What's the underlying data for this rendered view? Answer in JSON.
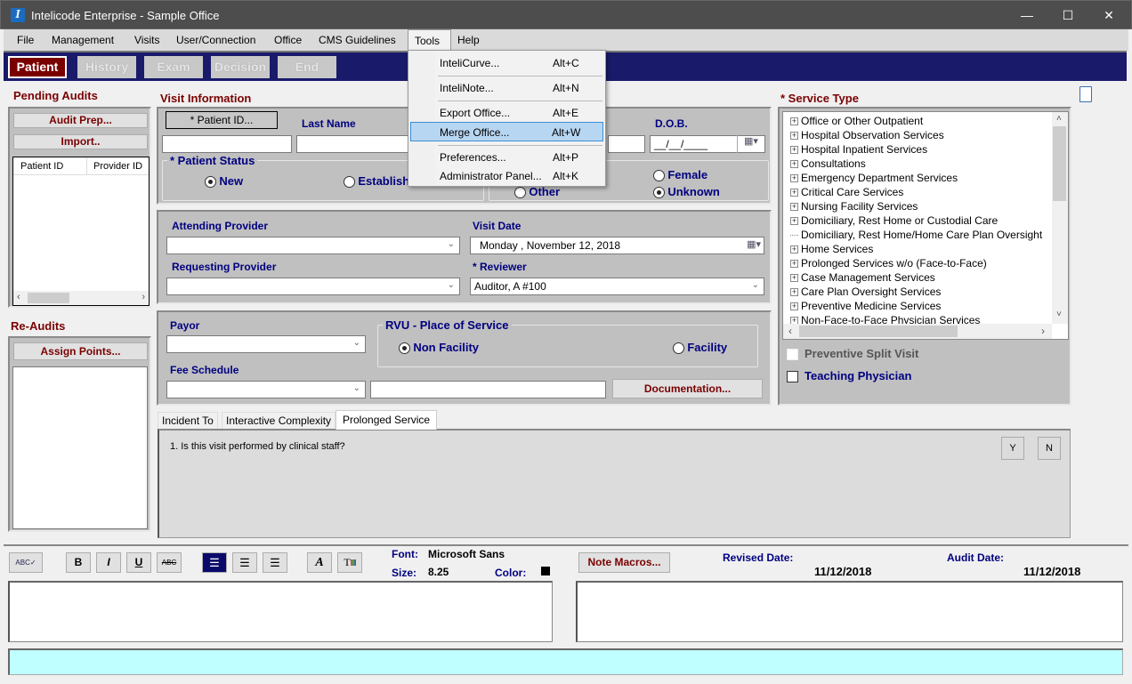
{
  "window": {
    "title": "Intelicode Enterprise  - Sample Office",
    "app_icon": "intelicode-logo-icon",
    "minimize": "—",
    "maximize": "☐",
    "close": "✕"
  },
  "menu": {
    "items": [
      "File",
      "Management",
      "Visits",
      "User/Connection",
      "Office",
      "CMS Guidelines",
      "Tools",
      "Help"
    ],
    "open": "Tools"
  },
  "tools_menu": {
    "items": [
      {
        "label": "InteliCurve...",
        "shortcut": "Alt+C"
      },
      {
        "label": "InteliNote...",
        "shortcut": "Alt+N"
      },
      {
        "label": "Export Office...",
        "shortcut": "Alt+E"
      },
      {
        "label": "Merge Office...",
        "shortcut": "Alt+W",
        "highlighted": true
      },
      {
        "label": "Preferences...",
        "shortcut": "Alt+P"
      },
      {
        "label": "Administrator Panel...",
        "shortcut": "Alt+K"
      }
    ]
  },
  "wizard_tabs": [
    {
      "label": "Patient",
      "active": true
    },
    {
      "label": "History",
      "active": false
    },
    {
      "label": "Exam",
      "active": false
    },
    {
      "label": "Decision",
      "active": false
    },
    {
      "label": "End",
      "active": false
    }
  ],
  "pending_audits": {
    "title": "Pending Audits",
    "audit_prep": "Audit Prep...",
    "import": "Import..",
    "columns": [
      "Patient ID",
      "Provider ID"
    ],
    "rows": []
  },
  "re_audits": {
    "title": "Re-Audits",
    "assign_points": "Assign Points..."
  },
  "visit_info": {
    "title": "Visit Information",
    "patient_id_button": "* Patient ID...",
    "last_name_label": "Last Name",
    "dob_label": "D.O.B.",
    "dob_value": "__/__/____",
    "patient_status_label": "* Patient Status",
    "status_options": [
      {
        "label": "New",
        "selected": true
      },
      {
        "label": "Established",
        "selected": false
      }
    ],
    "gender_options": [
      {
        "label": "Other",
        "selected": false
      },
      {
        "label": "Female",
        "selected": false
      },
      {
        "label": "Unknown",
        "selected": true
      }
    ],
    "attending_provider_label": "Attending Provider",
    "attending_provider_value": "",
    "visit_date_label": "Visit Date",
    "visit_date_value": "Monday   , November 12, 2018",
    "requesting_provider_label": "Requesting Provider",
    "requesting_provider_value": "",
    "reviewer_label": "* Reviewer",
    "reviewer_value": "Auditor, A #100",
    "payor_label": "Payor",
    "fee_schedule_label": "Fee Schedule",
    "rvu_label": "RVU - Place of Service",
    "rvu_options": [
      {
        "label": "Non Facility",
        "selected": true
      },
      {
        "label": "Facility",
        "selected": false
      }
    ],
    "documentation_button": "Documentation..."
  },
  "service_type": {
    "title": "* Service Type",
    "items": [
      {
        "label": "Office or Other Outpatient",
        "expandable": true
      },
      {
        "label": "Hospital Observation Services",
        "expandable": true
      },
      {
        "label": "Hospital Inpatient Services",
        "expandable": true
      },
      {
        "label": "Consultations",
        "expandable": true
      },
      {
        "label": "Emergency Department Services",
        "expandable": true
      },
      {
        "label": "Critical Care Services",
        "expandable": true
      },
      {
        "label": "Nursing Facility Services",
        "expandable": true
      },
      {
        "label": "Domiciliary, Rest Home or Custodial Care",
        "expandable": true
      },
      {
        "label": "Domiciliary, Rest Home/Home Care Plan Oversight",
        "expandable": false
      },
      {
        "label": "Home Services",
        "expandable": true
      },
      {
        "label": "Prolonged Services w/o (Face-to-Face)",
        "expandable": true
      },
      {
        "label": "Case Management Services",
        "expandable": true
      },
      {
        "label": "Care Plan Oversight Services",
        "expandable": true
      },
      {
        "label": "Preventive Medicine Services",
        "expandable": true
      },
      {
        "label": "Non-Face-to-Face Physician Services",
        "expandable": true
      }
    ],
    "preventive_split_visit": {
      "label": "Preventive Split Visit",
      "checked": false,
      "enabled": false
    },
    "teaching_physician": {
      "label": "Teaching Physician",
      "checked": false
    }
  },
  "lower_tabs": {
    "tabs": [
      "Incident To",
      "Interactive Complexity",
      "Prolonged Service"
    ],
    "active": "Prolonged Service",
    "question": "1. Is this visit performed by clinical staff?",
    "yes": "Y",
    "no": "N"
  },
  "editor": {
    "toolbar": {
      "spell": "ABC✓",
      "bold": "B",
      "italic": "I",
      "underline": "U",
      "strike": "ABC"
    },
    "font_label": "Font:",
    "font_value": "Microsoft Sans",
    "size_label": "Size:",
    "size_value": "8.25",
    "color_label": "Color:",
    "color_value": "#000000",
    "note_macros": "Note Macros...",
    "revised_date_label": "Revised Date:",
    "revised_date_value": "11/12/2018",
    "audit_date_label": "Audit Date:",
    "audit_date_value": "11/12/2018"
  },
  "colors": {
    "accent_red": "#7a0000",
    "label_blue": "#000080",
    "wizard_bar": "#1a1a6b",
    "status_bar": "#c0ffff",
    "menu_highlight": "#b7d6f2"
  }
}
